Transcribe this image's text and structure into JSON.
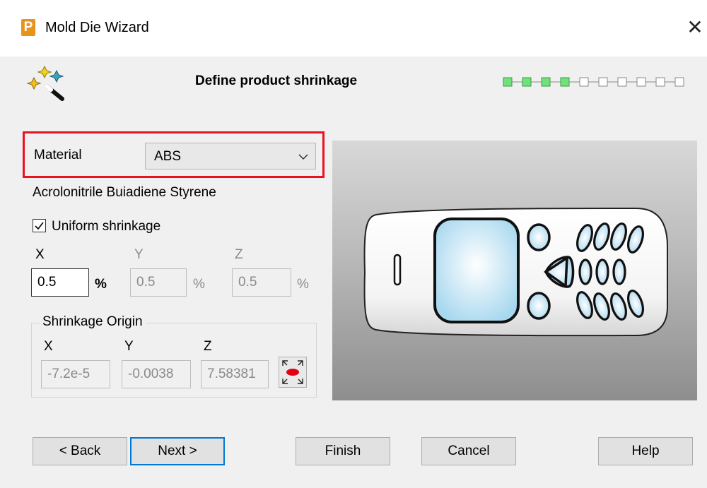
{
  "window": {
    "app_icon_letter": "P",
    "title": "Mold Die Wizard",
    "close_glyph": "✕"
  },
  "header": {
    "step_title": "Define product shrinkage",
    "progress": {
      "total_steps": 10,
      "completed_steps": 4,
      "completed_color": "#6fe37a"
    }
  },
  "material": {
    "label": "Material",
    "selected": "ABS",
    "description": "Acrolonitrile Buiadiene Styrene"
  },
  "shrinkage": {
    "uniform_label": "Uniform shrinkage",
    "uniform_checked": true,
    "x_label": "X",
    "y_label": "Y",
    "z_label": "Z",
    "x_value": "0.5",
    "y_value": "0.5",
    "z_value": "0.5",
    "percent": "%"
  },
  "origin": {
    "group_label": "Shrinkage Origin",
    "x_label": "X",
    "y_label": "Y",
    "z_label": "Z",
    "x_value": "-7.2e-5",
    "y_value": "-0.0038",
    "z_value": "7.58381"
  },
  "buttons": {
    "back": "< Back",
    "next": "Next >",
    "finish": "Finish",
    "cancel": "Cancel",
    "help": "Help"
  },
  "colors": {
    "highlight": "#e8131f",
    "focus": "#0078d7",
    "preview_screen": "#bfe3f5"
  }
}
